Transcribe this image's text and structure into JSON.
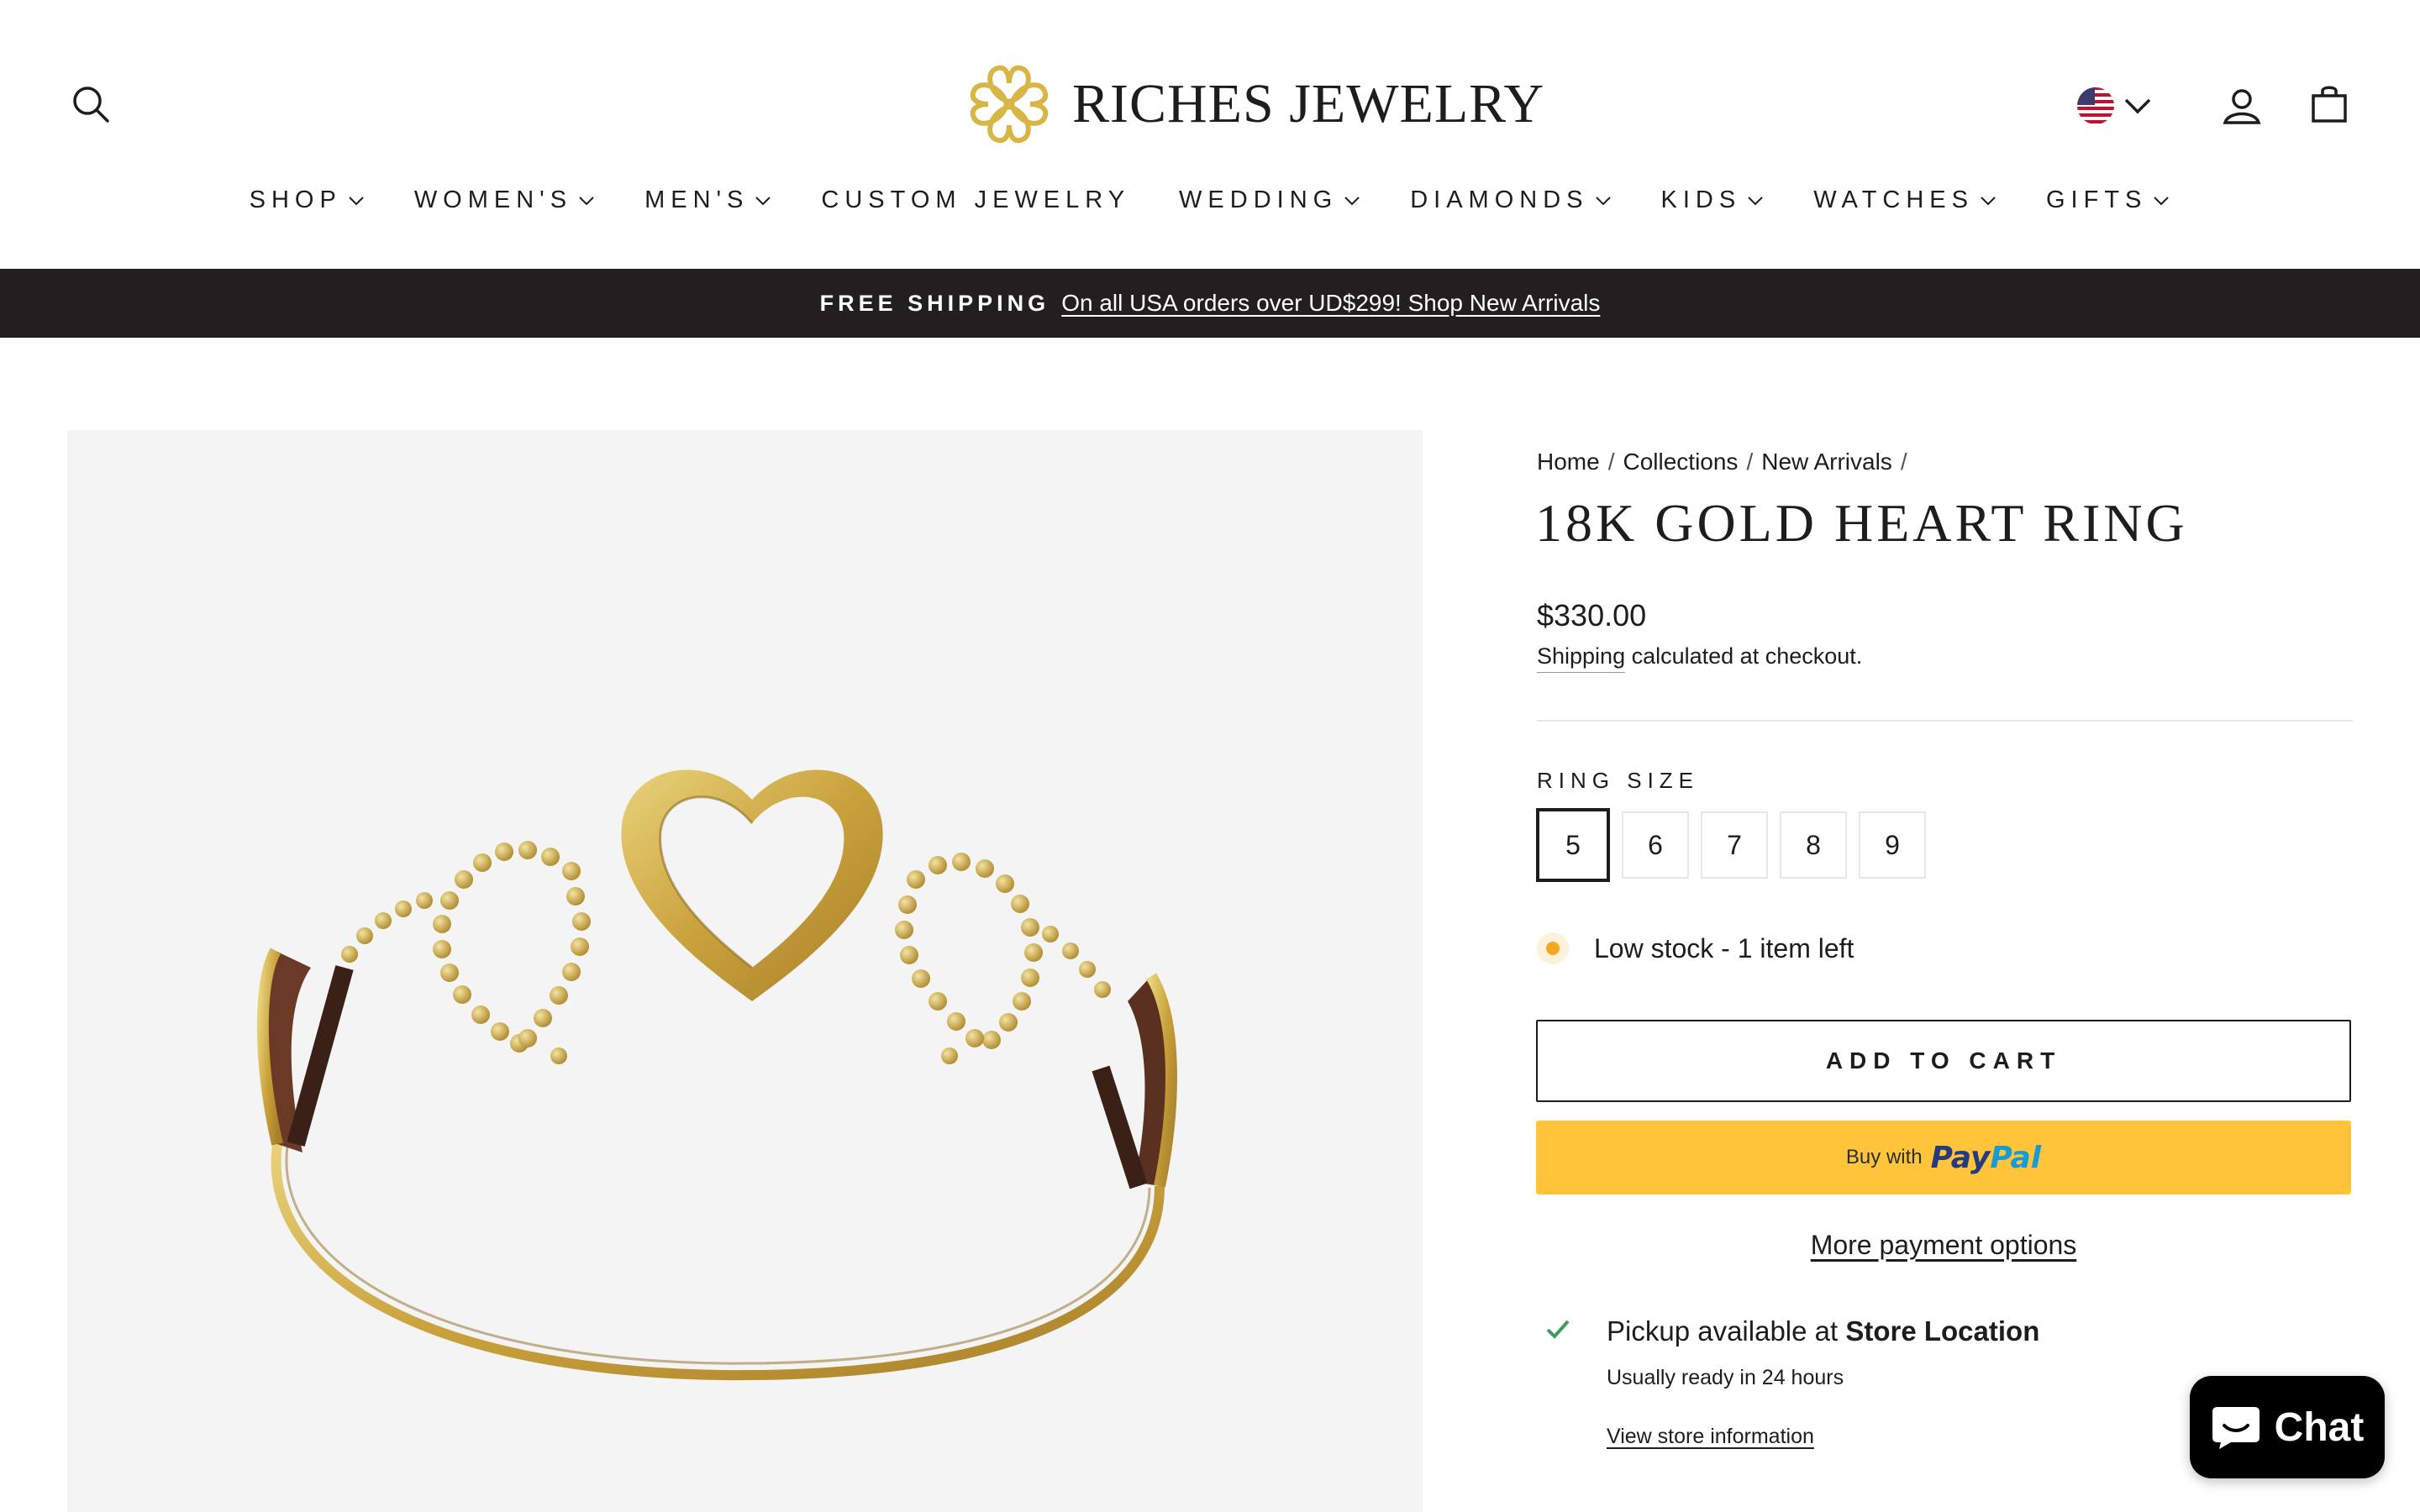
{
  "header": {
    "brand": "RICHES JEWELRY",
    "icons": {
      "search": "search-icon",
      "flag": "us-flag-icon",
      "account": "account-icon",
      "cart": "cart-icon"
    },
    "nav": [
      {
        "label": "SHOP",
        "dropdown": true
      },
      {
        "label": "WOMEN'S",
        "dropdown": true
      },
      {
        "label": "MEN'S",
        "dropdown": true
      },
      {
        "label": "CUSTOM JEWELRY",
        "dropdown": false
      },
      {
        "label": "WEDDING",
        "dropdown": true
      },
      {
        "label": "DIAMONDS",
        "dropdown": true
      },
      {
        "label": "KIDS",
        "dropdown": true
      },
      {
        "label": "WATCHES",
        "dropdown": true
      },
      {
        "label": "GIFTS",
        "dropdown": true
      }
    ]
  },
  "announcement": {
    "strong": "FREE SHIPPING",
    "link": "On all USA orders over UD$299! Shop New Arrivals"
  },
  "breadcrumb": [
    "Home",
    "Collections",
    "New Arrivals"
  ],
  "product": {
    "title": "18K GOLD HEART RING",
    "price": "$330.00",
    "shipping_link": "Shipping",
    "shipping_rest": " calculated at checkout.",
    "size_label": "RING SIZE",
    "sizes": [
      "5",
      "6",
      "7",
      "8",
      "9"
    ],
    "selected_size": "5",
    "stock": "Low stock - 1 item left",
    "add_to_cart": "ADD TO CART",
    "paypal_buy": "Buy with",
    "paypal_brand_1": "Pay",
    "paypal_brand_2": "Pal",
    "more_payment": "More payment options",
    "pickup_prefix": "Pickup available at ",
    "pickup_location": "Store Location",
    "ready": "Usually ready in 24 hours",
    "store_info": "View store information"
  },
  "chat": {
    "label": "Chat"
  },
  "colors": {
    "announcement_bg": "#231f20",
    "paypal_bg": "#ffc439",
    "stock_dot": "#f5a623",
    "check": "#3f9e5c",
    "gold": "#d8b645"
  }
}
